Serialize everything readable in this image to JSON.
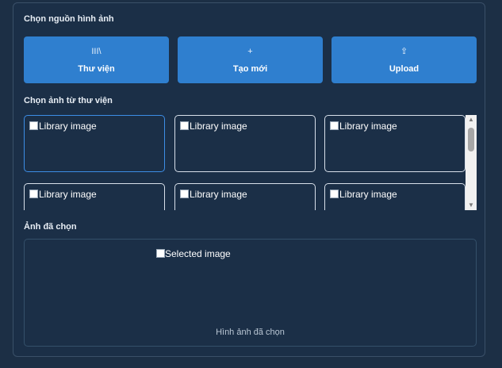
{
  "source_section": {
    "title": "Chọn nguồn hình ảnh",
    "buttons": [
      {
        "icon": "library-icon",
        "glyph": "III\\",
        "label": "Thư viện"
      },
      {
        "icon": "plus-icon",
        "glyph": "+",
        "label": "Tạo mới"
      },
      {
        "icon": "upload-icon",
        "glyph": "⇪",
        "label": "Upload"
      }
    ]
  },
  "library_section": {
    "title": "Chọn ảnh từ thư viện",
    "images": [
      {
        "alt": "Library image",
        "selected": true
      },
      {
        "alt": "Library image",
        "selected": false
      },
      {
        "alt": "Library image",
        "selected": false
      },
      {
        "alt": "Library image",
        "selected": false
      },
      {
        "alt": "Library image",
        "selected": false
      },
      {
        "alt": "Library image",
        "selected": false
      }
    ]
  },
  "selected_section": {
    "title": "Ảnh đã chọn",
    "image_alt": "Selected image",
    "caption": "Hình ảnh đã chọn"
  },
  "colors": {
    "background": "#1c2f45",
    "accent": "#2f7fcf",
    "selected_border": "#3d8ee6"
  }
}
